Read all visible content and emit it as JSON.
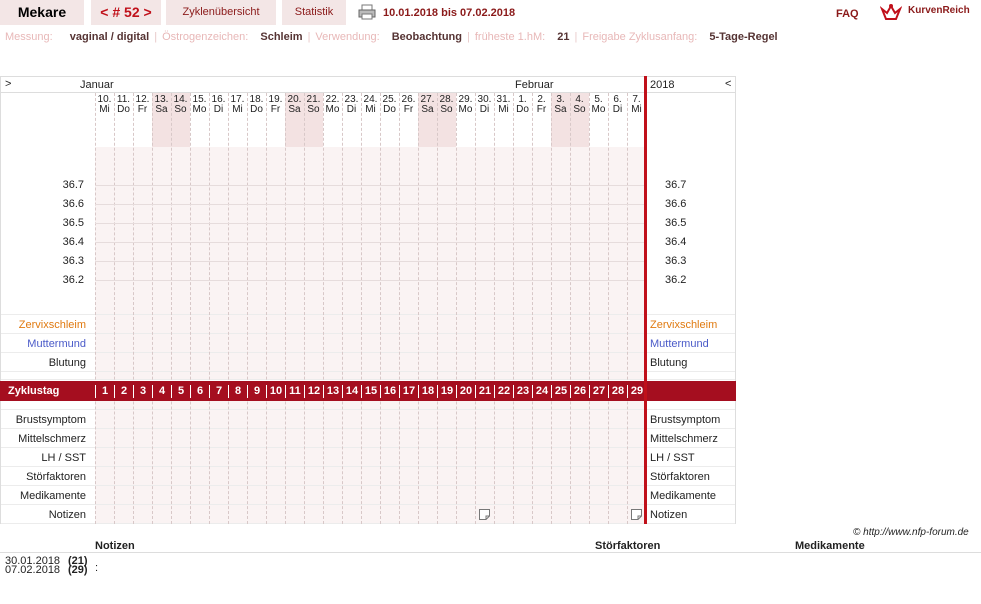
{
  "top": {
    "user": "Mekare",
    "cycle": "< # 52 >",
    "overview": "Zyklenübersicht",
    "stats": "Statistik",
    "date_range": "10.01.2018 bis 07.02.2018",
    "faq": "FAQ",
    "logo": "KurvenReich"
  },
  "settings": {
    "messung_lbl": "Messung:",
    "messung_val": "vaginal / digital",
    "oestro_lbl": "Östrogenzeichen:",
    "oestro_val": "Schleim",
    "verw_lbl": "Verwendung:",
    "verw_val": "Beobachtung",
    "fhm_lbl": "früheste 1.hM:",
    "fhm_val": "21",
    "frei_lbl": "Freigabe Zyklusanfang:",
    "frei_val": "5-Tage-Regel"
  },
  "chart": {
    "left_arrow": ">",
    "right_arrow": "<",
    "month1": "Januar",
    "month2": "Februar",
    "year": "2018",
    "days": [
      {
        "d": "10.",
        "w": "Mi",
        "we": false
      },
      {
        "d": "11.",
        "w": "Do",
        "we": false
      },
      {
        "d": "12.",
        "w": "Fr",
        "we": false
      },
      {
        "d": "13.",
        "w": "Sa",
        "we": true
      },
      {
        "d": "14.",
        "w": "So",
        "we": true
      },
      {
        "d": "15.",
        "w": "Mo",
        "we": false
      },
      {
        "d": "16.",
        "w": "Di",
        "we": false
      },
      {
        "d": "17.",
        "w": "Mi",
        "we": false
      },
      {
        "d": "18.",
        "w": "Do",
        "we": false
      },
      {
        "d": "19.",
        "w": "Fr",
        "we": false
      },
      {
        "d": "20.",
        "w": "Sa",
        "we": true
      },
      {
        "d": "21.",
        "w": "So",
        "we": true
      },
      {
        "d": "22.",
        "w": "Mo",
        "we": false
      },
      {
        "d": "23.",
        "w": "Di",
        "we": false
      },
      {
        "d": "24.",
        "w": "Mi",
        "we": false
      },
      {
        "d": "25.",
        "w": "Do",
        "we": false
      },
      {
        "d": "26.",
        "w": "Fr",
        "we": false
      },
      {
        "d": "27.",
        "w": "Sa",
        "we": true
      },
      {
        "d": "28.",
        "w": "So",
        "we": true
      },
      {
        "d": "29.",
        "w": "Mo",
        "we": false
      },
      {
        "d": "30.",
        "w": "Di",
        "we": false
      },
      {
        "d": "31.",
        "w": "Mi",
        "we": false
      },
      {
        "d": "1.",
        "w": "Do",
        "we": false
      },
      {
        "d": "2.",
        "w": "Fr",
        "we": false
      },
      {
        "d": "3.",
        "w": "Sa",
        "we": true
      },
      {
        "d": "4.",
        "w": "So",
        "we": true
      },
      {
        "d": "5.",
        "w": "Mo",
        "we": false
      },
      {
        "d": "6.",
        "w": "Di",
        "we": false
      },
      {
        "d": "7.",
        "w": "Mi",
        "we": false
      }
    ],
    "temps": [
      "36.7",
      "36.6",
      "36.5",
      "36.4",
      "36.3",
      "36.2"
    ],
    "rows_top": [
      {
        "label": "Zervixschleim",
        "color": "#e07a10"
      },
      {
        "label": "Muttermund",
        "color": "#4a5ac8"
      },
      {
        "label": "Blutung",
        "color": "#222222"
      }
    ],
    "cycle_label": "Zyklustag",
    "cycle_days": [
      "1",
      "2",
      "3",
      "4",
      "5",
      "6",
      "7",
      "8",
      "9",
      "10",
      "11",
      "12",
      "13",
      "14",
      "15",
      "16",
      "17",
      "18",
      "19",
      "20",
      "21",
      "22",
      "23",
      "24",
      "25",
      "26",
      "27",
      "28",
      "29"
    ],
    "rows_bottom": [
      "Brustsymptom",
      "Mittelschmerz",
      "LH / SST",
      "Störfaktoren",
      "Medikamente",
      "Notizen"
    ]
  },
  "footer": {
    "copyright": "© http://www.nfp-forum.de",
    "col_notes": "Notizen",
    "col_stoer": "Störfaktoren",
    "col_med": "Medikamente",
    "lines": [
      {
        "date": "30.01.2018",
        "day": "(21)"
      },
      {
        "date": "07.02.2018",
        "day": "(29)"
      }
    ],
    "colon": ":"
  }
}
